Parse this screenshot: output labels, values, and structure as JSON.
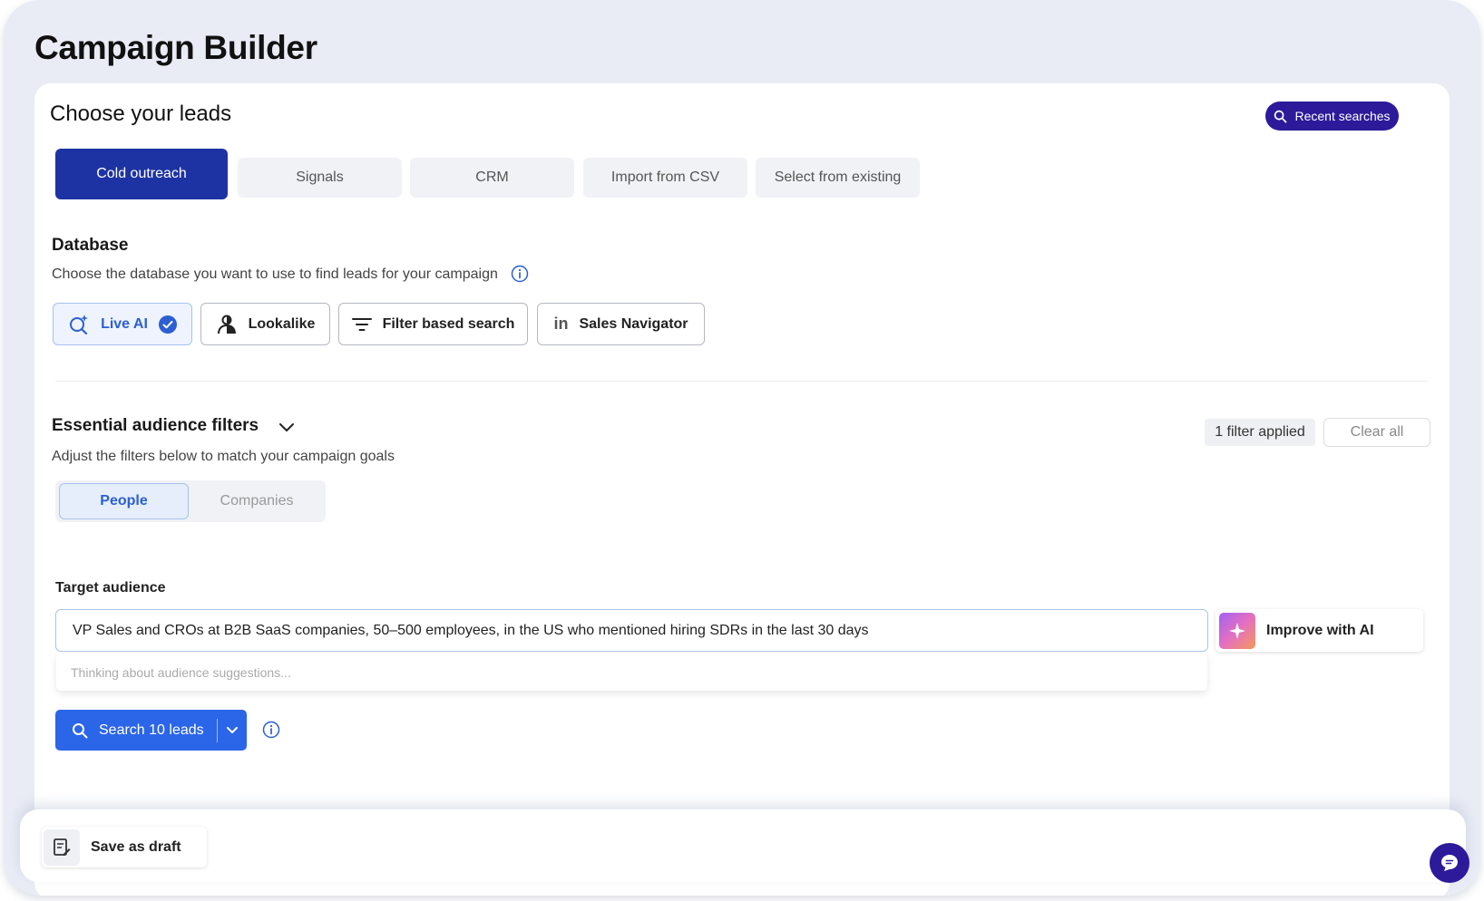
{
  "page": {
    "title": "Campaign Builder"
  },
  "leads": {
    "title": "Choose your leads",
    "recent_searches_label": "Recent searches",
    "tabs": [
      {
        "label": "Cold outreach",
        "active": true
      },
      {
        "label": "Signals",
        "active": false
      },
      {
        "label": "CRM",
        "active": false
      },
      {
        "label": "Import from CSV",
        "active": false
      },
      {
        "label": "Select from existing",
        "active": false
      }
    ]
  },
  "database": {
    "title": "Database",
    "description": "Choose the database you want to use to find leads for your campaign",
    "options": [
      {
        "label": "Live AI",
        "icon": "ai-search-icon",
        "selected": true
      },
      {
        "label": "Lookalike",
        "icon": "lookalike-person-icon",
        "selected": false
      },
      {
        "label": "Filter based search",
        "icon": "filter-lines-icon",
        "selected": false
      },
      {
        "label": "Sales Navigator",
        "icon": "linkedin-icon",
        "selected": false
      }
    ]
  },
  "filters": {
    "title": "Essential audience filters",
    "description": "Adjust the filters below to match your campaign goals",
    "applied_label": "1 filter applied",
    "clear_label": "Clear all",
    "segments": [
      {
        "label": "People",
        "active": true
      },
      {
        "label": "Companies",
        "active": false
      }
    ]
  },
  "audience": {
    "label": "Target audience",
    "value": "VP Sales and CROs at B2B SaaS companies, 50–500 employees, in the US who mentioned hiring SDRs in the last 30 days",
    "suggestion_text": "Thinking about audience suggestions...",
    "improve_label": "Improve with AI"
  },
  "search": {
    "label": "Search 10 leads"
  },
  "footer": {
    "save_draft_label": "Save as draft"
  },
  "colors": {
    "primary_dark": "#2c1a9a",
    "tab_active": "#1e33a3",
    "search_blue": "#2b66e8",
    "selected_blue": "#2c5fd1",
    "background": "#e9ecf5"
  }
}
